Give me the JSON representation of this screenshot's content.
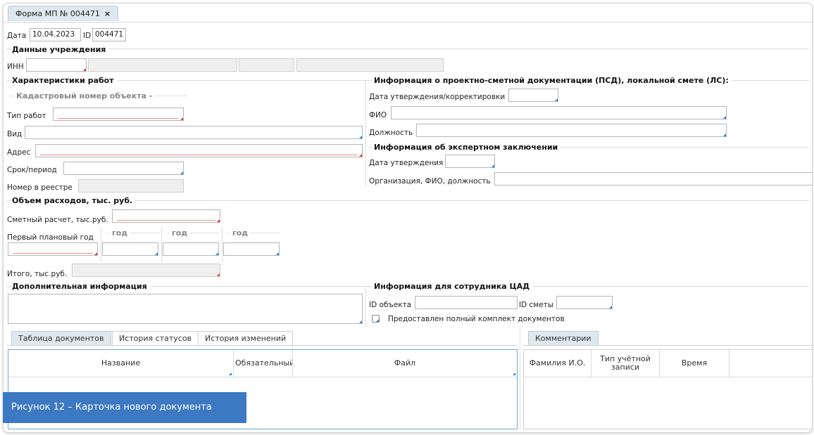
{
  "document_tab": {
    "title": "Форма МП № 004471",
    "close": "×"
  },
  "header": {
    "date_label": "Дата",
    "date_value": "10.04.2023",
    "id_label": "ID",
    "id_value": "004471"
  },
  "institution": {
    "title": "Данные учреждения",
    "inn_label": "ИНН"
  },
  "work": {
    "title": "Характеристики работ",
    "cadastral_title": "Кадастровый номер объекта -",
    "work_type_label": "Тип работ",
    "kind_label": "Вид",
    "address_label": "Адрес",
    "period_label": "Срок/период",
    "registry_label": "Номер в реестре"
  },
  "psd": {
    "title": "Информация о проектно-сметной документации (ПСД), локальной смете (ЛС):",
    "approval_label": "Дата утверждения/корректировки",
    "fio_label": "ФИО",
    "position_label": "Должность"
  },
  "expert": {
    "title": "Информация об экспертном заключении",
    "approval_label": "Дата утверждения",
    "org_label": "Организация, ФИО, должность"
  },
  "expenses": {
    "title": "Объем расходов, тыс. руб.",
    "estimate_label": "Сметный расчет, тыс.руб.",
    "first_year_label": "Первый плановый год",
    "year1": "год",
    "year2": "год",
    "year3": "год",
    "total_label": "Итого, тыс.руб."
  },
  "additional": {
    "title": "Дополнительная информация"
  },
  "cad": {
    "title": "Информация для сотрудника ЦАД",
    "object_id_label": "ID объекта",
    "estimate_id_label": "ID сметы",
    "full_set_label": "Предоставлен полный комплект документов"
  },
  "doc_tabs": [
    "Таблица документов",
    "История статусов",
    "История изменений"
  ],
  "doc_table": {
    "columns": [
      "Название",
      "Обязательный",
      "Файл"
    ]
  },
  "comments": {
    "tab": "Комментарии",
    "columns": [
      "Фамилия И.О.",
      "Тип учётной записи",
      "Время"
    ]
  },
  "caption": "Рисунок 12 – Карточка  нового документа"
}
